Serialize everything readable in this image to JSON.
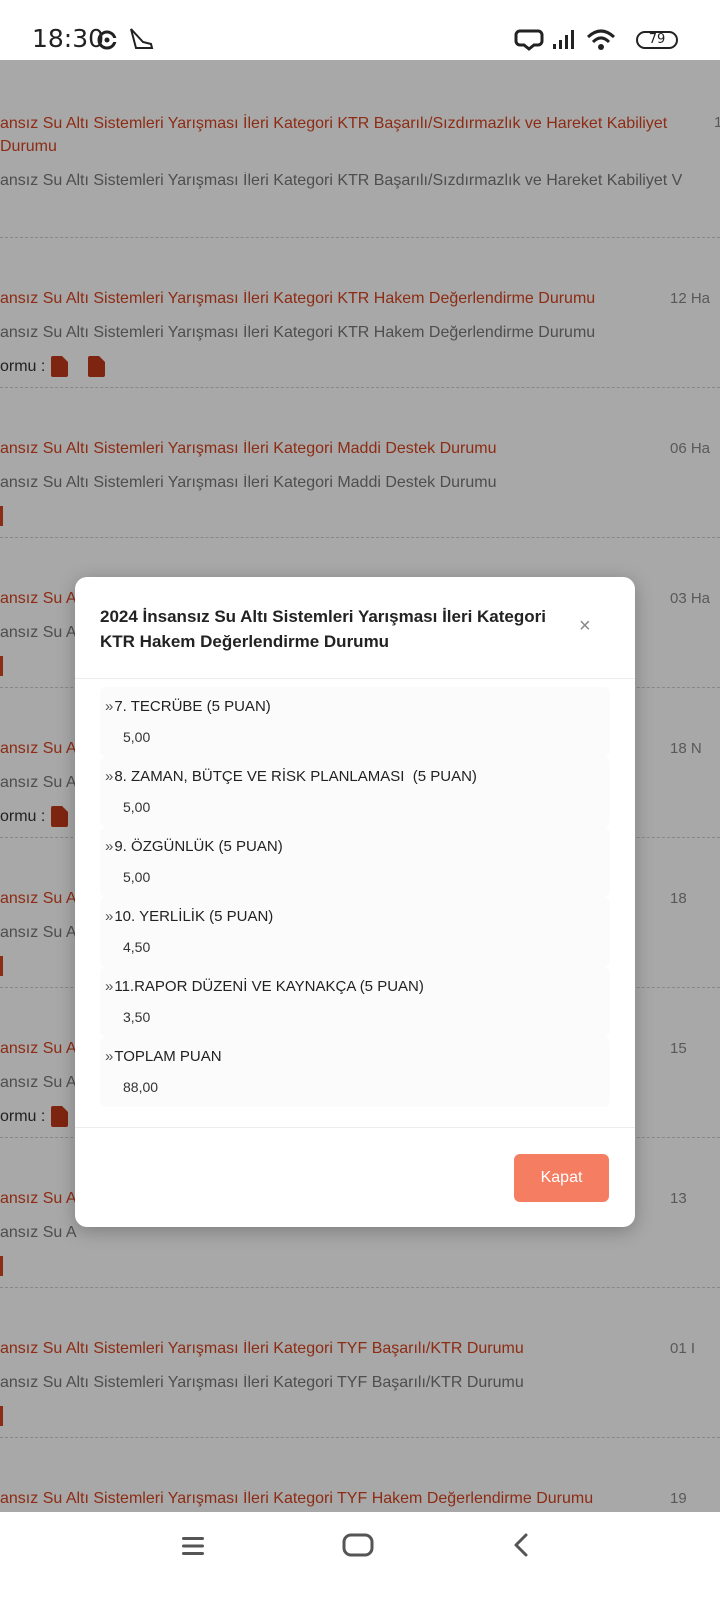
{
  "status_bar": {
    "time": "18:30",
    "battery": "79",
    "icons": [
      "sync-icon",
      "airplane-app-icon",
      "hotspot-icon",
      "signal-icon",
      "wifi-icon",
      "battery-icon"
    ]
  },
  "list": {
    "rows": [
      {
        "title": "ansız Su Altı Sistemleri Yarışması İleri Kategori KTR Başarılı/Sızdırmazlık ve Hareket Kabiliyet Durumu",
        "date": "1",
        "desc": "ansız Su Altı Sistemleri Yarışması İleri Kategori KTR Başarılı/Sızdırmazlık ve Hareket Kabiliyet V",
        "forms_label": ""
      },
      {
        "title": "ansız Su Altı Sistemleri Yarışması İleri Kategori KTR Hakem Değerlendirme Durumu",
        "date": "12 Ha",
        "desc": "ansız Su Altı Sistemleri Yarışması İleri Kategori KTR Hakem Değerlendirme Durumu",
        "forms_label": "ormu :"
      },
      {
        "title": "ansız Su Altı Sistemleri Yarışması İleri Kategori Maddi Destek Durumu",
        "date": "06 Ha",
        "desc": "ansız Su Altı Sistemleri Yarışması İleri Kategori Maddi Destek Durumu",
        "forms_label": ""
      },
      {
        "title": "ansız Su A",
        "date": "03 Ha",
        "desc": "ansız Su A",
        "forms_label": ""
      },
      {
        "title": "ansız Su A",
        "date": "18 N",
        "desc": "ansız Su A",
        "forms_label": "ormu :"
      },
      {
        "title": "ansız Su A",
        "date": "18",
        "desc": "ansız Su A",
        "forms_label": ""
      },
      {
        "title": "ansız Su A",
        "date": "15",
        "desc": "ansız Su A",
        "forms_label": "ormu :"
      },
      {
        "title": "ansız Su A",
        "date": "13",
        "desc": "ansız Su A",
        "forms_label": ""
      },
      {
        "title": "ansız Su Altı Sistemleri Yarışması İleri Kategori TYF Başarılı/KTR Durumu",
        "date": "01 I",
        "desc": "ansız Su Altı Sistemleri Yarışması İleri Kategori TYF Başarılı/KTR Durumu",
        "forms_label": ""
      },
      {
        "title": "ansız Su Altı Sistemleri Yarışması İleri Kategori TYF Hakem Değerlendirme Durumu",
        "date": "19",
        "desc": "",
        "forms_label": ""
      }
    ]
  },
  "modal": {
    "title": "2024 İnsansız Su Altı Sistemleri Yarışması İleri Kategori KTR Hakem Değerlendirme Durumu",
    "close_symbol": "×",
    "scores": [
      {
        "label": "7. TECRÜBE (5 PUAN)",
        "value": "5,00"
      },
      {
        "label": "8. ZAMAN, BÜTÇE VE RİSK PLANLAMASI  (5 PUAN)",
        "value": "5,00"
      },
      {
        "label": "9. ÖZGÜNLÜK (5 PUAN)",
        "value": "5,00"
      },
      {
        "label": "10. YERLİLİK (5 PUAN)",
        "value": "4,50"
      },
      {
        "label": "11.RAPOR DÜZENİ VE KAYNAKÇA (5 PUAN)",
        "value": "3,50"
      },
      {
        "label": "TOPLAM PUAN",
        "value": "88,00"
      }
    ],
    "close_button": "Kapat",
    "colors": {
      "button": "#f47d62",
      "title_red": "#d6441f"
    }
  },
  "nav_bar": {
    "icons": [
      "menu-icon",
      "home-icon",
      "back-icon"
    ]
  }
}
